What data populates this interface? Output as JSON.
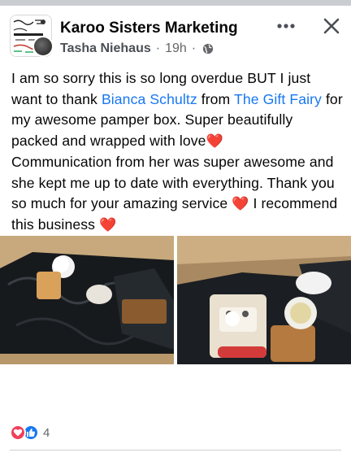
{
  "header": {
    "page_name": "Karoo Sisters Marketing",
    "author": "Tasha Niehaus",
    "time": "19h",
    "separator": "·",
    "privacy_icon": "globe-icon",
    "more_icon": "more-horizontal-icon",
    "close_icon": "close-icon"
  },
  "post": {
    "text_1": "I am so sorry this is so long overdue BUT I just want to thank ",
    "mention_1": "Bianca Schultz",
    "text_2": " from ",
    "mention_2": "The Gift Fairy",
    "text_3": " for my awesome pamper box. Super beautifully packed and wrapped with love",
    "text_4": "Communication from her was super awesome and she kept me up to date with everything. Thank you so much for your amazing service ",
    "text_5": " I recommend this business ",
    "heart": "❤️"
  },
  "photos": [
    {
      "alt_icon": "photo-icon"
    },
    {
      "alt_icon": "photo-icon"
    }
  ],
  "reactions": {
    "icons": [
      "love-icon",
      "like-icon"
    ],
    "count": "4"
  },
  "colors": {
    "link": "#1877f2",
    "meta": "#65676b",
    "text": "#050505",
    "heart": "#e4212b"
  }
}
